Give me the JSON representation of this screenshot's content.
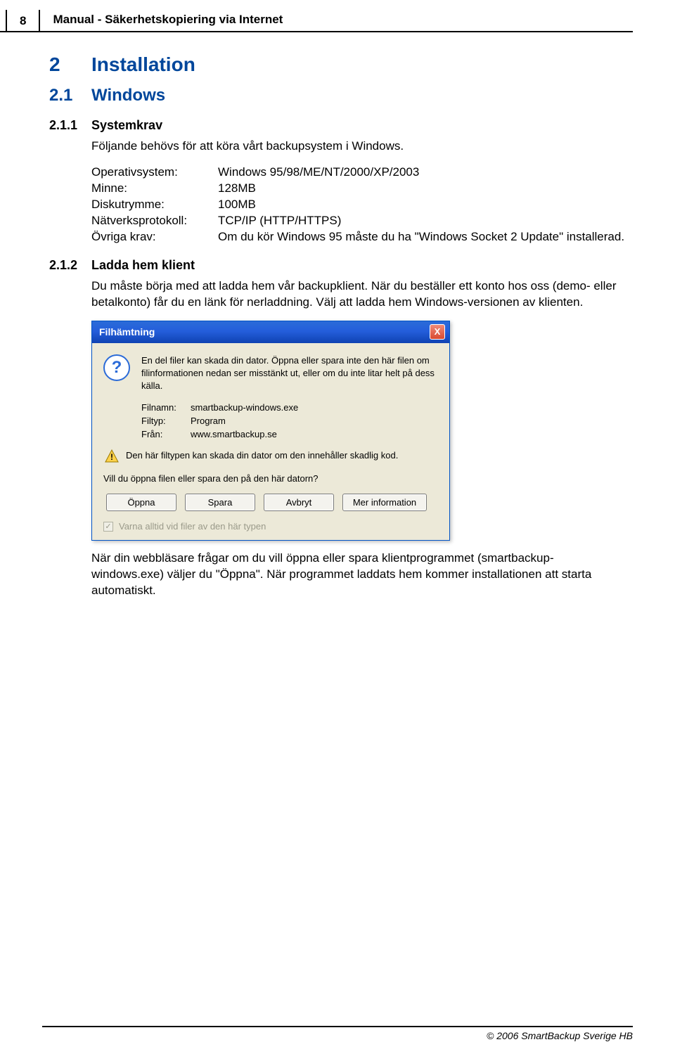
{
  "header": {
    "page_number": "8",
    "title": "Manual - Säkerhetskopiering via Internet"
  },
  "sections": {
    "s2": {
      "num": "2",
      "title": "Installation"
    },
    "s21": {
      "num": "2.1",
      "title": "Windows"
    },
    "s211": {
      "num": "2.1.1",
      "title": "Systemkrav",
      "intro": "Följande behövs för att köra vårt backupsystem i Windows.",
      "requirements": [
        {
          "label": "Operativsystem:",
          "value": "Windows 95/98/ME/NT/2000/XP/2003"
        },
        {
          "label": "Minne:",
          "value": "128MB"
        },
        {
          "label": "Diskutrymme:",
          "value": "100MB"
        },
        {
          "label": "Nätverksprotokoll:",
          "value": "TCP/IP (HTTP/HTTPS)"
        },
        {
          "label": "Övriga krav:",
          "value": "Om du kör Windows 95 måste du ha \"Windows Socket 2 Update\" installerad."
        }
      ]
    },
    "s212": {
      "num": "2.1.2",
      "title": "Ladda hem klient",
      "p1": "Du måste börja med att ladda hem vår backupklient. När du beställer ett konto hos oss (demo- eller betalkonto) får du en länk för nerladdning. Välj att ladda hem Windows-versionen av klienten.",
      "p2": "När din webbläsare frågar om du vill öppna eller spara klientprogrammet (smartbackup-windows.exe) väljer du \"Öppna\". När programmet laddats hem kommer installationen att starta automatiskt."
    }
  },
  "dialog": {
    "title": "Filhämtning",
    "close": "X",
    "intro": "En del filer kan skada din dator. Öppna eller spara inte den här filen om filinformationen nedan ser misstänkt ut, eller om du inte litar helt på dess källa.",
    "meta": {
      "filename_label": "Filnamn:",
      "filename_value": "smartbackup-windows.exe",
      "filetype_label": "Filtyp:",
      "filetype_value": "Program",
      "from_label": "Från:",
      "from_value": "www.smartbackup.se"
    },
    "warning": "Den här filtypen kan skada din dator om den innehåller skadlig kod.",
    "prompt": "Vill du öppna filen eller spara den på den här datorn?",
    "buttons": {
      "open": "Öppna",
      "save": "Spara",
      "cancel": "Avbryt",
      "info": "Mer information"
    },
    "checkbox": "Varna alltid vid filer av den här typen"
  },
  "footer": {
    "copyright": "© 2006 SmartBackup Sverige HB"
  }
}
